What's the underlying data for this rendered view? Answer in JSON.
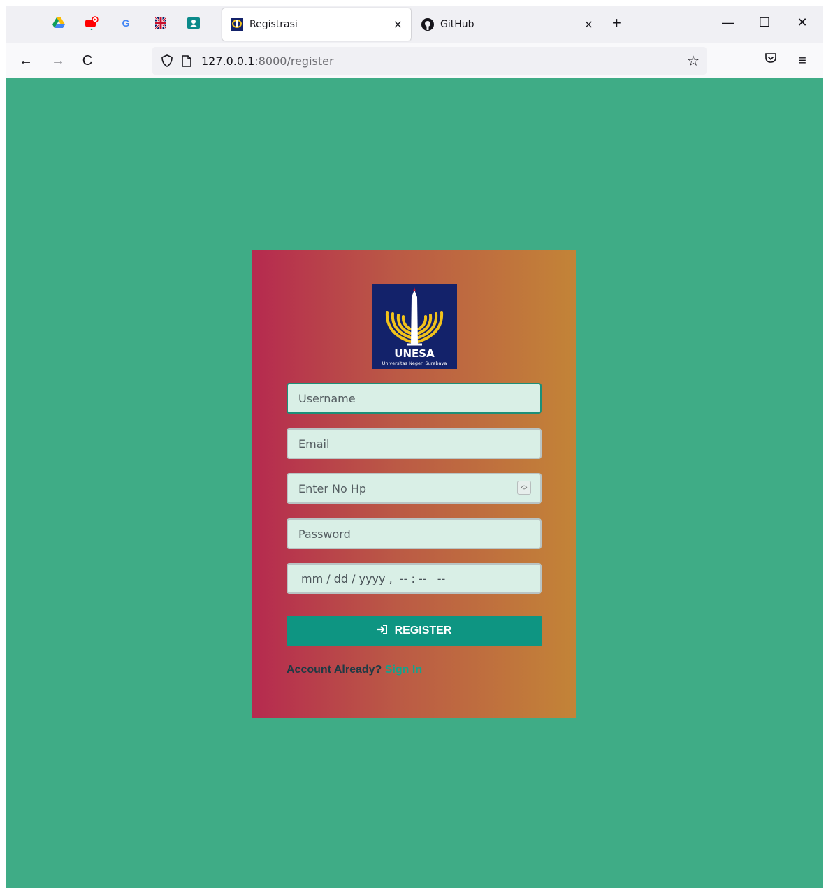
{
  "browser": {
    "pinned_tabs": [
      {
        "icon": "google-drive-icon"
      },
      {
        "icon": "youtube-icon"
      },
      {
        "icon": "google-icon",
        "glyph": "G"
      },
      {
        "icon": "uk-flag-icon"
      },
      {
        "icon": "contacts-icon"
      }
    ],
    "tabs": [
      {
        "title": "Registrasi",
        "active": true,
        "close": "×"
      },
      {
        "title": "GitHub",
        "active": false,
        "close": "×"
      }
    ],
    "new_tab": "+",
    "window_controls": {
      "minimize": "—",
      "maximize": "☐",
      "close": "✕"
    },
    "nav": {
      "back": "←",
      "forward": "→",
      "reload": "C"
    },
    "url": {
      "host": "127.0.0.1",
      "path": ":8000/register"
    },
    "bookmark_star": "☆",
    "pocket": "♡",
    "menu": "≡"
  },
  "page": {
    "background": "#3fac86",
    "logo": {
      "text": "UNESA",
      "subtitle": "Universitas Negeri Surabaya"
    },
    "form": {
      "username_placeholder": "Username",
      "email_placeholder": "Email",
      "phone_placeholder": "Enter No Hp",
      "password_placeholder": "Password",
      "datetime_placeholder": "mm / dd / yyyy ,  -- : --   --",
      "register_label": "REGISTER",
      "account_prompt": "Account Already?",
      "signin_link": "Sign In"
    },
    "colors": {
      "button": "#0e9582",
      "link": "#16a28c",
      "card_left": "#b62a4f",
      "card_right": "#c38437"
    }
  }
}
